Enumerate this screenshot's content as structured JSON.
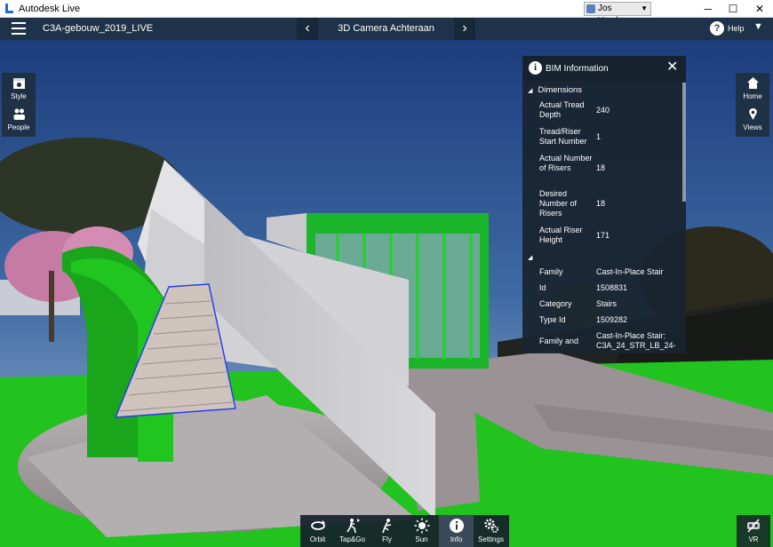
{
  "window": {
    "app_title": "Autodesk Live",
    "user_name": "Jos Vandam...",
    "controls": [
      "─",
      "☐",
      "✕"
    ]
  },
  "header": {
    "project_title": "C3A-gebouw_2019_LIVE",
    "view_title": "3D Camera Achteraan",
    "prev_symbol": "‹",
    "next_symbol": "›",
    "help_label": "Help",
    "menu_caret": "▼"
  },
  "left_toolbar": [
    {
      "label": "Style",
      "icon": "style-icon"
    },
    {
      "label": "People",
      "icon": "people-icon"
    }
  ],
  "right_toolbar": [
    {
      "label": "Home",
      "icon": "home-icon"
    },
    {
      "label": "Views",
      "icon": "location-pin-icon"
    }
  ],
  "bim_panel": {
    "title": "BIM Information",
    "close": "✕",
    "sections": [
      {
        "title": "Dimensions",
        "properties": [
          {
            "key": "Actual Tread Depth",
            "value": "240"
          },
          {
            "key": "Tread/Riser Start Number",
            "value": "1"
          },
          {
            "key": "Actual Number of Risers",
            "value": "18"
          },
          {
            "key": "Desired Number of Risers",
            "value": "18"
          },
          {
            "key": "Actual Riser Height",
            "value": "171"
          }
        ]
      },
      {
        "title": "",
        "properties": [
          {
            "key": "Family",
            "value": "Cast-In-Place Stair"
          },
          {
            "key": "Id",
            "value": "1508831"
          },
          {
            "key": "Category",
            "value": "Stairs"
          },
          {
            "key": "Type Id",
            "value": "1509282"
          },
          {
            "key": "Family and",
            "value": "Cast-In-Place Stair: C3A_24_STR_LB_24-"
          }
        ]
      }
    ]
  },
  "bottom_toolbar": [
    {
      "label": "Orbit",
      "icon": "orbit-icon",
      "active": false
    },
    {
      "label": "Tap&Go",
      "icon": "tap-and-go-icon",
      "active": false
    },
    {
      "label": "Fly",
      "icon": "fly-icon",
      "active": false
    },
    {
      "label": "Sun",
      "icon": "sun-icon",
      "active": false
    },
    {
      "label": "Info",
      "icon": "info-icon",
      "active": true
    },
    {
      "label": "Settings",
      "icon": "settings-icon",
      "active": false
    }
  ],
  "vr_button": {
    "label": "VR",
    "icon": "vr-headset-icon"
  },
  "colors": {
    "header_bg": "#1e3349",
    "panel_bg": "#18242f",
    "grass": "#22c21f",
    "sky_top": "#1f3f7a",
    "selection_outline": "#2b3ee6"
  }
}
